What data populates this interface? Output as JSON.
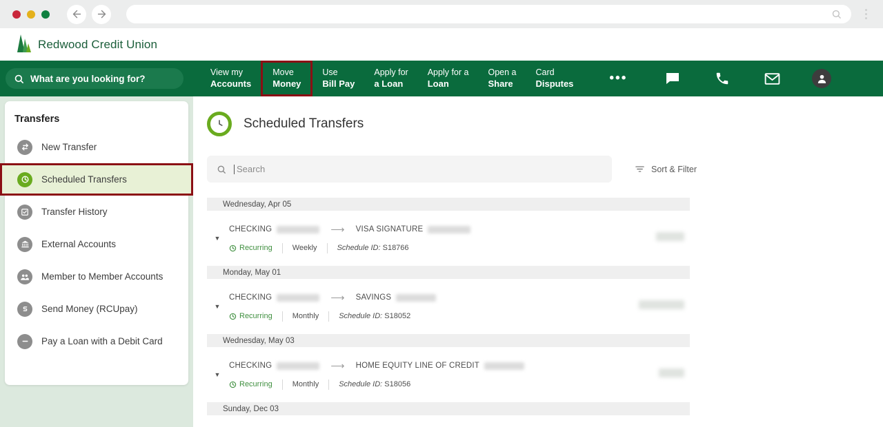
{
  "browser": {
    "traffic_lights": [
      "close",
      "minimize",
      "maximize"
    ],
    "back_label": "←",
    "forward_label": "→",
    "url_value": "",
    "url_placeholder": "",
    "search_icon": "search-icon",
    "menu_icon": "kebab-menu-icon"
  },
  "brand": {
    "name": "Redwood Credit Union",
    "logo_icon": "redwood-trees-logo"
  },
  "header": {
    "search": {
      "placeholder": "What are you looking for?",
      "value": "",
      "icon": "search-icon"
    },
    "nav_items": [
      {
        "line1": "View my",
        "line2": "Accounts",
        "active": false
      },
      {
        "line1": "Move",
        "line2": "Money",
        "active": true
      },
      {
        "line1": "Use",
        "line2": "Bill Pay",
        "active": false
      },
      {
        "line1": "Apply for",
        "line2": "a Loan",
        "active": false
      },
      {
        "line1": "Apply for a",
        "line2": "Loan",
        "active": false
      },
      {
        "line1": "Open a",
        "line2": "Share",
        "active": false
      },
      {
        "line1": "Card",
        "line2": "Disputes",
        "active": false
      }
    ],
    "more_label": "•••",
    "icons": [
      {
        "name": "chat-icon",
        "label": "Chat"
      },
      {
        "name": "phone-icon",
        "label": "Call"
      },
      {
        "name": "envelope-icon",
        "label": "Messages"
      },
      {
        "name": "user-avatar-icon",
        "label": "Account"
      }
    ],
    "colors": {
      "nav_green": "#0a6b3d",
      "search_pill_green": "#1b7a4d",
      "highlight_red": "#8b0f14"
    }
  },
  "sidebar": {
    "title": "Transfers",
    "items": [
      {
        "label": "New Transfer",
        "icon": "transfer-arrows-icon",
        "selected": false
      },
      {
        "label": "Scheduled Transfers",
        "icon": "clock-icon",
        "selected": true
      },
      {
        "label": "Transfer History",
        "icon": "history-icon",
        "selected": false
      },
      {
        "label": "External Accounts",
        "icon": "bank-icon",
        "selected": false
      },
      {
        "label": "Member to Member Accounts",
        "icon": "people-icon",
        "selected": false
      },
      {
        "label": "Send Money (RCUpay)",
        "icon": "dollar-circle-icon",
        "selected": false
      },
      {
        "label": "Pay a Loan with a Debit Card",
        "icon": "card-icon",
        "selected": false
      }
    ]
  },
  "main": {
    "page_title": "Scheduled Transfers",
    "page_icon": "clock-circle-icon",
    "search": {
      "placeholder": "Search",
      "value": "",
      "icon": "search-icon"
    },
    "sort_filter": {
      "label": "Sort & Filter",
      "icon": "filter-icon"
    },
    "groups": [
      {
        "date": "Wednesday, Apr 05",
        "transfers": [
          {
            "from_account": "CHECKING",
            "from_masked": true,
            "to_account": "VISA SIGNATURE",
            "to_masked": true,
            "recurring_label": "Recurring",
            "frequency": "Weekly",
            "schedule_id_label": "Schedule ID:",
            "schedule_id": "S18766",
            "amount_masked": true,
            "expand_icon": "chevron-down-icon"
          }
        ]
      },
      {
        "date": "Monday, May 01",
        "transfers": [
          {
            "from_account": "CHECKING",
            "from_masked": true,
            "to_account": "SAVINGS",
            "to_masked": true,
            "recurring_label": "Recurring",
            "frequency": "Monthly",
            "schedule_id_label": "Schedule ID:",
            "schedule_id": "S18052",
            "amount_masked": true,
            "expand_icon": "chevron-down-icon"
          }
        ]
      },
      {
        "date": "Wednesday, May 03",
        "transfers": [
          {
            "from_account": "CHECKING",
            "from_masked": true,
            "to_account": "HOME EQUITY LINE OF CREDIT",
            "to_masked": true,
            "recurring_label": "Recurring",
            "frequency": "Monthly",
            "schedule_id_label": "Schedule ID:",
            "schedule_id": "S18056",
            "amount_masked": true,
            "expand_icon": "chevron-down-icon"
          }
        ]
      },
      {
        "date": "Sunday, Dec 03",
        "transfers": []
      }
    ]
  }
}
